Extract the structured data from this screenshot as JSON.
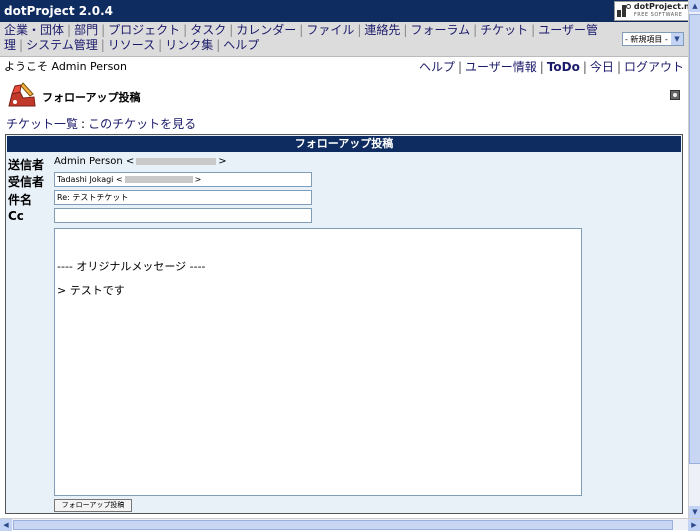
{
  "app": {
    "title": "dotProject 2.0.4"
  },
  "logo": {
    "name": "dotProject.net",
    "tagline": "FREE SOFTWARE"
  },
  "nav": {
    "items": [
      "企業・団体",
      "部門",
      "プロジェクト",
      "タスク",
      "カレンダー",
      "ファイル",
      "連絡先",
      "フォーラム",
      "チケット",
      "ユーザー管理",
      "システム管理",
      "リソース",
      "リンク集",
      "ヘルプ"
    ],
    "new_item": "- 新規項目 -"
  },
  "welcome": {
    "text": "ようこそ Admin Person"
  },
  "top_links": {
    "help": "ヘルプ",
    "user_info": "ユーザー情報",
    "todo": "ToDo",
    "today": "今日",
    "logout": "ログアウト"
  },
  "page": {
    "module_title": "フォローアップ投稿",
    "breadcrumb": {
      "list": "チケット一覧",
      "view": "このチケットを見る"
    }
  },
  "form": {
    "header": "フォローアップ投稿",
    "labels": {
      "from": "送信者",
      "to": "受信者",
      "subject": "件名",
      "cc": "Cc"
    },
    "from_name": "Admin Person",
    "to_name": "Tadashi Jokagi",
    "subject_value": "Re: テストチケット",
    "cc_value": "",
    "body_line1": "---- オリジナルメッセージ ----",
    "body_line2": "> テストです",
    "submit_label": "フォローアップ投稿"
  },
  "icons": {
    "module": "ticket-icon",
    "help": "help-icon",
    "dropdown": "chevron-down-icon"
  },
  "colors": {
    "header_bg": "#0e2c5f",
    "panel_bg": "#e9f1f8",
    "nav_bg": "#dcdcdc",
    "link": "#1a1a6a"
  }
}
